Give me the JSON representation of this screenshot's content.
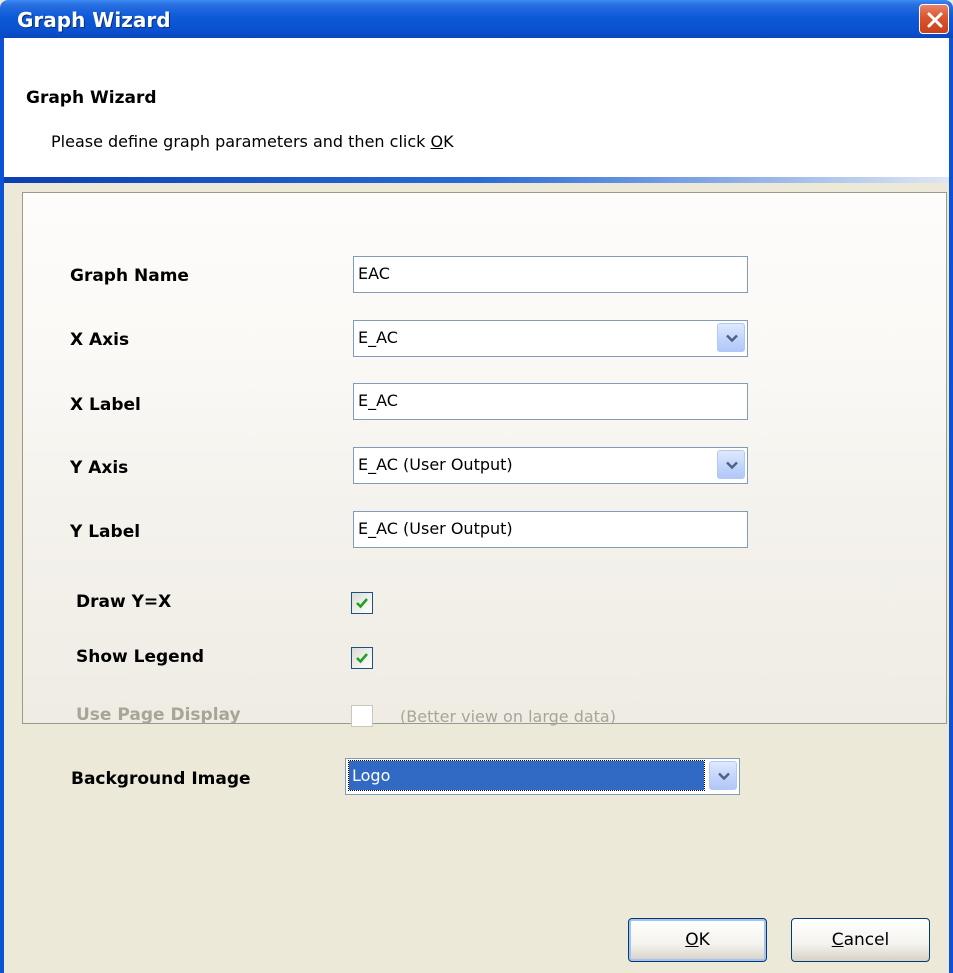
{
  "window": {
    "title": "Graph Wizard",
    "close_icon": "close-icon"
  },
  "header": {
    "title": "Graph Wizard",
    "description": "Please define graph parameters and then click OK"
  },
  "form": {
    "graph_name": {
      "label": "Graph Name",
      "value": "EAC"
    },
    "x_axis": {
      "label": "X Axis",
      "value": "E_AC"
    },
    "x_label": {
      "label": "X Label",
      "value": "E_AC"
    },
    "y_axis": {
      "label": "Y Axis",
      "value": "E_AC (User Output)"
    },
    "y_label": {
      "label": "Y Label",
      "value": "E_AC (User Output)"
    },
    "draw_y_eq_x": {
      "label": "Draw Y=X",
      "checked": true
    },
    "show_legend": {
      "label": "Show Legend",
      "checked": true
    },
    "use_page_display": {
      "label": "Use Page Display",
      "checked": false,
      "disabled": true,
      "hint": "(Better view on large data)"
    },
    "background_image": {
      "label": "Background Image",
      "value": "Logo"
    }
  },
  "buttons": {
    "ok": "OK",
    "cancel": "Cancel"
  },
  "colors": {
    "title_bar": "#0a51cf",
    "selection": "#316ac5",
    "disabled_text": "#a7a597"
  }
}
